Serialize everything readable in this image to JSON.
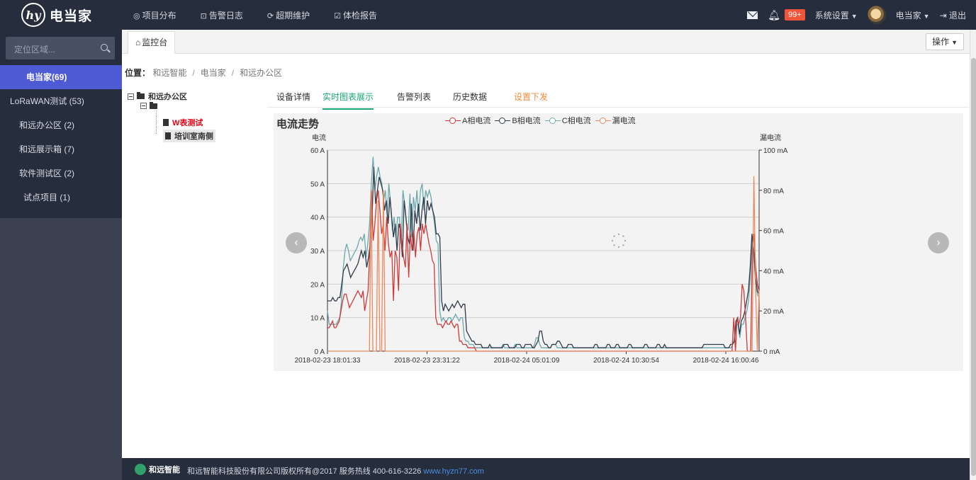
{
  "app": {
    "logo_mark": "hy",
    "logo_text": "电当家"
  },
  "topnav": [
    {
      "icon": "◎",
      "label": "项目分布"
    },
    {
      "icon": "⊡",
      "label": "告警日志"
    },
    {
      "icon": "⟳",
      "label": "超期维护"
    },
    {
      "icon": "☑",
      "label": "体检报告"
    }
  ],
  "topright": {
    "badge": "99+",
    "system_settings": "系统设置",
    "user_name": "电当家",
    "logout": "退出"
  },
  "sidebar": {
    "search_placeholder": "定位区域...",
    "items": [
      {
        "label": "电当家(69)",
        "active": true
      },
      {
        "label": "LoRaWAN测试 (53)",
        "active": false
      },
      {
        "label": "和远办公区 (2)",
        "active": false
      },
      {
        "label": "和远展示箱 (7)",
        "active": false
      },
      {
        "label": "软件测试区 (2)",
        "active": false
      },
      {
        "label": "试点项目 (1)",
        "active": false
      }
    ]
  },
  "tabbar": {
    "tab_label": "监控台",
    "operations": "操作"
  },
  "breadcrumb": {
    "label": "位置：",
    "parts": [
      "和远智能",
      "电当家",
      "和远办公区"
    ]
  },
  "tree": {
    "root": "和远办公区",
    "leaf_w": "W表测试",
    "leaf_pei": "培训室南侧"
  },
  "subtabs": [
    "设备详情",
    "实时图表展示",
    "告警列表",
    "历史数据",
    "设置下发"
  ],
  "colors": {
    "phaseA": "#cc3a3a",
    "phaseB": "#2f3a4a",
    "phaseC": "#6aa8ae",
    "leak": "#e98a5e",
    "accent": "#1aa57a"
  },
  "chart_data": {
    "type": "line",
    "title": "电流走势",
    "ylabel": "电流",
    "y2label": "漏电流",
    "ylim": [
      0,
      60
    ],
    "y2lim": [
      0,
      100
    ],
    "yticks": [
      "0 A",
      "10 A",
      "20 A",
      "30 A",
      "40 A",
      "50 A",
      "60 A"
    ],
    "y2ticks": [
      "0 mA",
      "20 mA",
      "40 mA",
      "60 mA",
      "80 mA",
      "100 mA"
    ],
    "xticks": [
      "2018-02-23 18:01:33",
      "2018-02-23 23:31:22",
      "2018-02-24 05:01:09",
      "2018-02-24 10:30:54",
      "2018-02-24 16:00:46"
    ],
    "series": [
      {
        "name": "A相电流",
        "axis": "left",
        "values": [
          7,
          7,
          8,
          9,
          7,
          7,
          8,
          9,
          12,
          15,
          17,
          17,
          15,
          13,
          14,
          15,
          16,
          17,
          18,
          17,
          16,
          18,
          12,
          15,
          18,
          30,
          48,
          33,
          38,
          45,
          48,
          42,
          35,
          38,
          30,
          40,
          32,
          28,
          30,
          15,
          30,
          28,
          18,
          38,
          32,
          28,
          25,
          38,
          22,
          35,
          30,
          36,
          28,
          35,
          37,
          30,
          38,
          35,
          38,
          35,
          32,
          30,
          27,
          26,
          10,
          8,
          8,
          8,
          7,
          8,
          9,
          8,
          8,
          9,
          8,
          7,
          8,
          8,
          3,
          3,
          2,
          2,
          2,
          1,
          1,
          1,
          1,
          1,
          0,
          0,
          0,
          0,
          0,
          0,
          0,
          0,
          0,
          0,
          0,
          0,
          0,
          0,
          0,
          0,
          0,
          0,
          0,
          0,
          0,
          0,
          0,
          0,
          0,
          0,
          0,
          0,
          0,
          0,
          0,
          0,
          0,
          0,
          0,
          0,
          0,
          0,
          0,
          0,
          0,
          0,
          0,
          0,
          0,
          0,
          0,
          0,
          0,
          0,
          0,
          0,
          0,
          0,
          0,
          0,
          0,
          0,
          0,
          0,
          0,
          0,
          0,
          0,
          0,
          0,
          0,
          0,
          0,
          0,
          0,
          0,
          0,
          0,
          0,
          0,
          0,
          0,
          0,
          0,
          0,
          0,
          0,
          0,
          0,
          0,
          0,
          0,
          0,
          0,
          0,
          0,
          0,
          0,
          0,
          0,
          0,
          0,
          0,
          0,
          0,
          0,
          0,
          0,
          0,
          0,
          0,
          0,
          0,
          0,
          0,
          0,
          0,
          0,
          0,
          0,
          0,
          0,
          0,
          0,
          0,
          0,
          0,
          0,
          0,
          0,
          0,
          0,
          0,
          0,
          0,
          0,
          0,
          0,
          0,
          0,
          0,
          0,
          0,
          0,
          0,
          0,
          0,
          0,
          0,
          0,
          0,
          0,
          0,
          0,
          0,
          0,
          10,
          0,
          10,
          8,
          10,
          20,
          18,
          10,
          0,
          0,
          0,
          30,
          35,
          25,
          20,
          18
        ]
      },
      {
        "name": "B相电流",
        "axis": "left",
        "values": [
          15,
          15,
          15,
          16,
          15,
          15,
          16,
          16,
          20,
          24,
          25,
          26,
          24,
          22,
          23,
          24,
          25,
          26,
          28,
          30,
          28,
          30,
          25,
          28,
          32,
          40,
          55,
          44,
          48,
          52,
          50,
          48,
          42,
          45,
          38,
          46,
          40,
          34,
          38,
          30,
          38,
          36,
          28,
          45,
          40,
          34,
          32,
          44,
          30,
          42,
          38,
          44,
          36,
          42,
          46,
          38,
          45,
          42,
          44,
          42,
          40,
          35,
          35,
          34,
          15,
          12,
          14,
          13,
          12,
          13,
          14,
          13,
          14,
          15,
          14,
          13,
          14,
          14,
          6,
          5,
          4,
          3,
          3,
          2,
          2,
          2,
          2,
          1,
          1,
          1,
          1,
          2,
          1,
          1,
          1,
          1,
          1,
          1,
          1,
          2,
          2,
          2,
          1,
          1,
          1,
          1,
          2,
          2,
          2,
          1,
          1,
          2,
          2,
          2,
          2,
          1,
          1,
          2,
          3,
          6,
          6,
          3,
          2,
          2,
          1,
          1,
          2,
          2,
          2,
          3,
          3,
          2,
          1,
          1,
          1,
          2,
          2,
          2,
          1,
          1,
          1,
          1,
          1,
          1,
          1,
          1,
          1,
          1,
          1,
          1,
          2,
          2,
          1,
          1,
          1,
          1,
          1,
          2,
          2,
          1,
          1,
          1,
          2,
          2,
          1,
          1,
          1,
          1,
          1,
          2,
          2,
          1,
          1,
          1,
          1,
          1,
          1,
          1,
          2,
          2,
          1,
          1,
          1,
          1,
          1,
          2,
          2,
          1,
          1,
          2,
          1,
          1,
          1,
          1,
          1,
          1,
          1,
          1,
          1,
          1,
          1,
          1,
          1,
          1,
          1,
          1,
          1,
          1,
          1,
          1,
          1,
          2,
          2,
          2,
          2,
          2,
          2,
          2,
          2,
          2,
          2,
          2,
          2,
          1,
          1,
          1,
          2,
          2,
          3,
          9,
          10,
          5,
          9,
          10,
          12,
          15,
          18,
          25,
          35,
          30,
          22,
          18,
          17
        ]
      },
      {
        "name": "C相电流",
        "axis": "left",
        "values": [
          12,
          8,
          8,
          8,
          8,
          8,
          9,
          10,
          15,
          25,
          30,
          32,
          30,
          27,
          28,
          29,
          30,
          31,
          33,
          34,
          33,
          35,
          28,
          32,
          38,
          50,
          58,
          48,
          52,
          55,
          52,
          50,
          45,
          48,
          40,
          50,
          44,
          36,
          40,
          34,
          40,
          40,
          32,
          48,
          44,
          38,
          36,
          47,
          34,
          46,
          42,
          48,
          40,
          48,
          50,
          42,
          48,
          46,
          48,
          46,
          42,
          38,
          33,
          32,
          12,
          9,
          10,
          9,
          9,
          10,
          10,
          9,
          10,
          11,
          10,
          9,
          10,
          10,
          4,
          3,
          3,
          2,
          2,
          2,
          1,
          1,
          1,
          1,
          1,
          1,
          1,
          1,
          1,
          1,
          1,
          1,
          1,
          1,
          1,
          1,
          2,
          1,
          1,
          1,
          1,
          1,
          1,
          2,
          1,
          1,
          1,
          1,
          1,
          1,
          1,
          1,
          1,
          1,
          2,
          4,
          4,
          2,
          1,
          1,
          1,
          1,
          1,
          1,
          2,
          2,
          2,
          1,
          1,
          1,
          1,
          1,
          1,
          1,
          1,
          1,
          1,
          1,
          1,
          1,
          1,
          1,
          1,
          1,
          1,
          1,
          1,
          1,
          1,
          1,
          1,
          1,
          1,
          1,
          1,
          1,
          1,
          1,
          1,
          1,
          1,
          1,
          1,
          1,
          1,
          1,
          1,
          1,
          1,
          1,
          1,
          1,
          1,
          1,
          1,
          1,
          1,
          1,
          1,
          1,
          1,
          1,
          1,
          1,
          1,
          1,
          1,
          1,
          1,
          1,
          1,
          1,
          1,
          1,
          1,
          1,
          1,
          1,
          1,
          1,
          1,
          1,
          1,
          1,
          1,
          1,
          1,
          1,
          1,
          1,
          1,
          1,
          1,
          1,
          1,
          1,
          1,
          1,
          1,
          1,
          1,
          1,
          1,
          1,
          1,
          1,
          1,
          2,
          3,
          8,
          8,
          4,
          8,
          8,
          10,
          12,
          15,
          22,
          33,
          28,
          20,
          17,
          16
        ]
      },
      {
        "name": "漏电流",
        "axis": "right",
        "values": [
          0,
          0,
          0,
          0,
          0,
          0,
          0,
          0,
          0,
          0,
          0,
          0,
          0,
          0,
          0,
          0,
          0,
          0,
          0,
          0,
          0,
          0,
          0,
          0,
          0,
          80,
          0,
          0,
          0,
          75,
          0,
          0,
          80,
          0,
          0,
          0,
          0,
          0,
          0,
          0,
          0,
          0,
          0,
          0,
          0,
          0,
          0,
          0,
          0,
          0,
          0,
          0,
          0,
          0,
          0,
          0,
          0,
          0,
          0,
          0,
          0,
          0,
          0,
          0,
          0,
          0,
          0,
          0,
          0,
          0,
          0,
          0,
          0,
          0,
          0,
          0,
          0,
          0,
          0,
          0,
          0,
          0,
          0,
          0,
          0,
          0,
          0,
          0,
          0,
          0,
          0,
          0,
          0,
          0,
          0,
          0,
          0,
          0,
          0,
          0,
          0,
          0,
          0,
          0,
          0,
          0,
          0,
          0,
          0,
          0,
          0,
          0,
          0,
          0,
          0,
          0,
          0,
          0,
          0,
          0,
          0,
          0,
          0,
          0,
          0,
          0,
          0,
          0,
          0,
          0,
          0,
          0,
          0,
          0,
          0,
          0,
          0,
          0,
          0,
          0,
          0,
          0,
          0,
          0,
          0,
          0,
          0,
          0,
          0,
          0,
          0,
          0,
          0,
          0,
          0,
          0,
          0,
          0,
          0,
          0,
          0,
          0,
          0,
          0,
          0,
          0,
          0,
          0,
          0,
          0,
          0,
          0,
          0,
          0,
          0,
          0,
          0,
          0,
          0,
          0,
          0,
          0,
          0,
          0,
          0,
          0,
          0,
          0,
          0,
          0,
          0,
          0,
          0,
          0,
          0,
          0,
          0,
          0,
          0,
          0,
          0,
          0,
          0,
          0,
          0,
          0,
          0,
          0,
          0,
          0,
          0,
          0,
          0,
          0,
          0,
          0,
          0,
          0,
          0,
          0,
          0,
          0,
          0,
          0,
          0,
          0,
          0,
          0,
          0,
          0,
          0,
          0,
          0,
          0,
          0,
          0,
          0,
          0,
          0,
          0,
          0,
          0,
          0,
          0,
          87,
          30,
          0,
          30
        ]
      }
    ]
  },
  "footer": {
    "logo_text": "和远智能",
    "copyright": "和远智能科技股份有限公司版权所有@2017 服务热线 400-616-3226",
    "link": "www.hyzn77.com"
  }
}
